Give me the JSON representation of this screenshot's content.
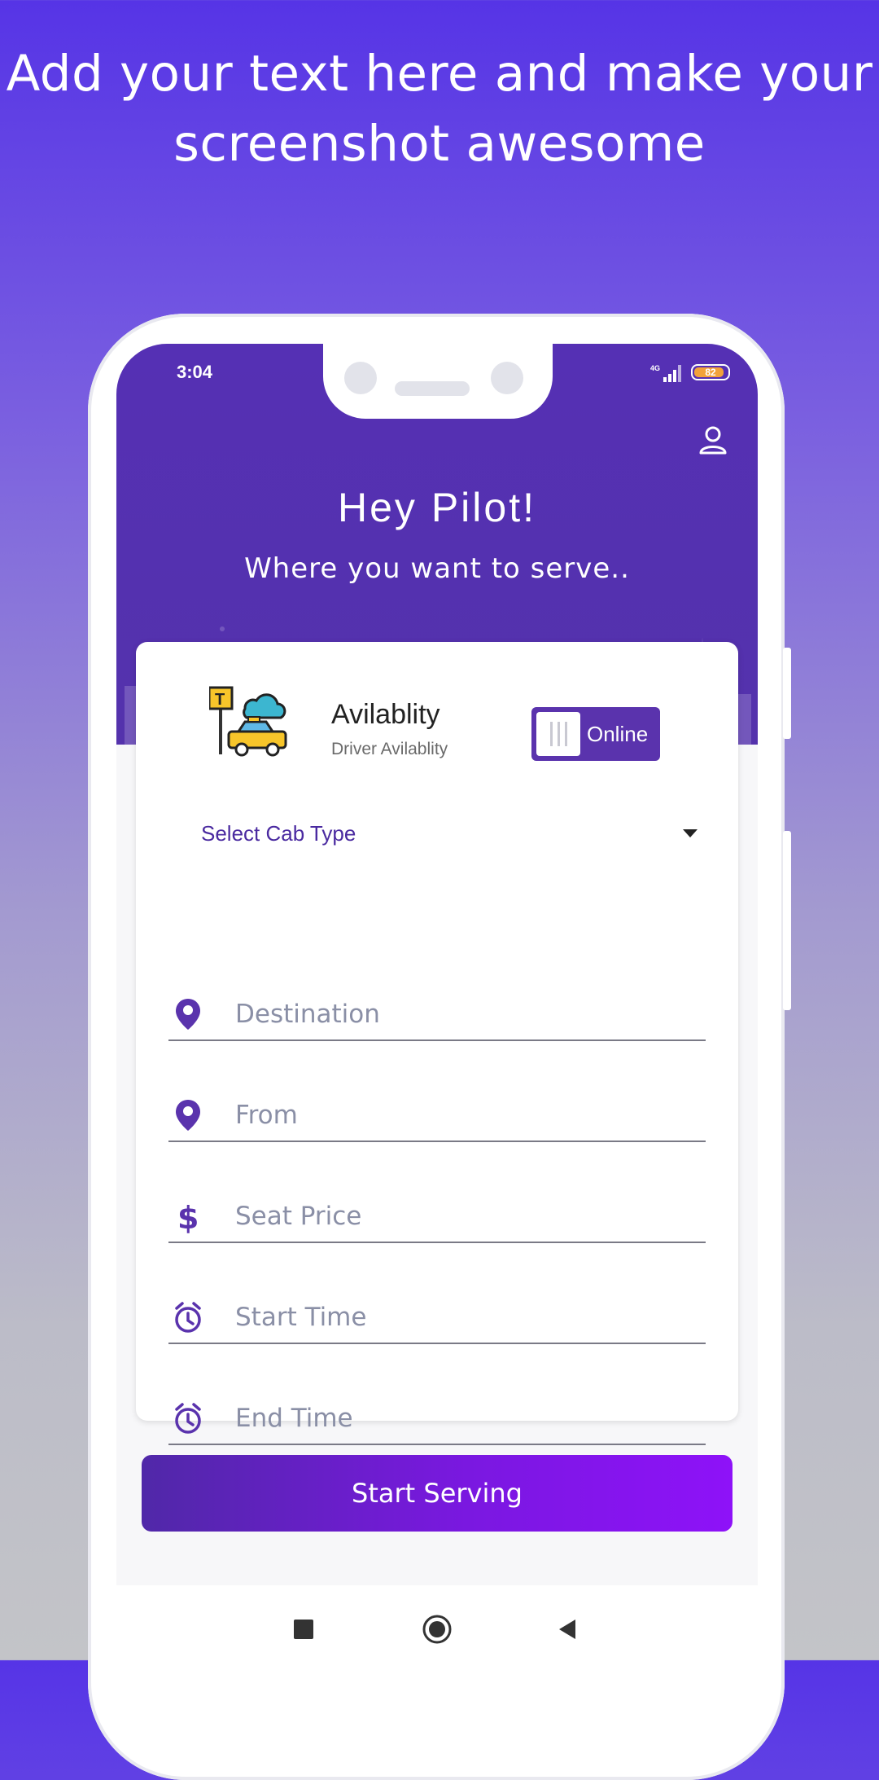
{
  "promo": {
    "line1": "Add your text here and make your",
    "line2": "screenshot awesome"
  },
  "status_bar": {
    "time": "3:04",
    "network": "4G",
    "battery": "82"
  },
  "header": {
    "greeting": "Hey Pilot!",
    "subtitle": "Where you want to serve.."
  },
  "availability": {
    "title": "Avilablity",
    "subtitle": "Driver Avilablity",
    "toggle_label": "Online",
    "toggle_state": true
  },
  "cab_select": {
    "value": "Select Cab Type"
  },
  "fields": [
    {
      "placeholder": "Destination",
      "icon": "location-pin-icon"
    },
    {
      "placeholder": "From",
      "icon": "location-pin-icon"
    },
    {
      "placeholder": "Seat Price",
      "icon": "dollar-icon"
    },
    {
      "placeholder": "Start Time",
      "icon": "alarm-clock-icon"
    },
    {
      "placeholder": "End Time",
      "icon": "alarm-clock-icon"
    }
  ],
  "actions": {
    "start_label": "Start Serving"
  },
  "colors": {
    "primary": "#5530b4",
    "accent": "#8e12f8",
    "background_top": "#5634e6"
  }
}
